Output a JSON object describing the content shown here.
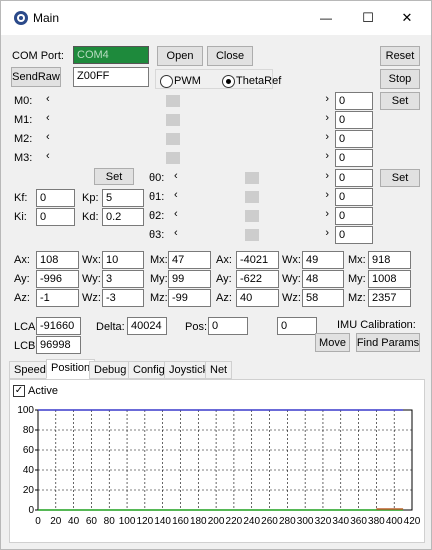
{
  "window": {
    "title": "Main",
    "minimize_glyph": "—",
    "maximize_glyph": "☐",
    "close_glyph": "✕"
  },
  "com": {
    "label": "COM Port:",
    "value": "COM4",
    "open": "Open",
    "close": "Close",
    "reset": "Reset",
    "stop": "Stop"
  },
  "send": {
    "button": "SendRaw",
    "value": "Z00FF",
    "pwm": "PWM",
    "thetaref": "ThetaRef",
    "mode": "ThetaRef"
  },
  "motors": [
    {
      "label": "M0:",
      "value": "0",
      "thumb": 0.44
    },
    {
      "label": "M1:",
      "value": "0",
      "thumb": 0.44
    },
    {
      "label": "M2:",
      "value": "0",
      "thumb": 0.44
    },
    {
      "label": "M3:",
      "value": "0",
      "thumb": 0.44
    }
  ],
  "motors_set": "Set",
  "gains": {
    "set": "Set",
    "kf_label": "Kf:",
    "kf": "0",
    "kp_label": "Kp:",
    "kp": "5",
    "ki_label": "Ki:",
    "ki": "0",
    "kd_label": "Kd:",
    "kd": "0.2"
  },
  "thetas": [
    {
      "label": "θ0:",
      "value": "0",
      "thumb": 0.5
    },
    {
      "label": "θ1:",
      "value": "0",
      "thumb": 0.5
    },
    {
      "label": "θ2:",
      "value": "0",
      "thumb": 0.5
    },
    {
      "label": "θ3:",
      "value": "0",
      "thumb": 0.5
    }
  ],
  "thetas_set": "Set",
  "imu": {
    "row_a": [
      [
        "Ax:",
        "108"
      ],
      [
        "Wx:",
        "10"
      ],
      [
        "Mx:",
        "47"
      ],
      [
        "Ax:",
        "-4021"
      ],
      [
        "Wx:",
        "49"
      ],
      [
        "Mx:",
        "918"
      ]
    ],
    "row_b": [
      [
        "Ay:",
        "-996"
      ],
      [
        "Wy:",
        "3"
      ],
      [
        "My:",
        "99"
      ],
      [
        "Ay:",
        "-622"
      ],
      [
        "Wy:",
        "48"
      ],
      [
        "My:",
        "1008"
      ]
    ],
    "row_c": [
      [
        "Az:",
        "-1"
      ],
      [
        "Wz:",
        "-3"
      ],
      [
        "Mz:",
        "-99"
      ],
      [
        "Az:",
        "40"
      ],
      [
        "Wz:",
        "58"
      ],
      [
        "Mz:",
        "2357"
      ]
    ]
  },
  "pos": {
    "lca_label": "LCA:",
    "lca": "-91660",
    "delta_label": "Delta:",
    "delta": "40024",
    "pos_label": "Pos:",
    "pos1": "0",
    "pos2": "0",
    "lcb_label": "LCB:",
    "lcb": "96998",
    "imu_cal": "IMU Calibration:",
    "move": "Move",
    "find": "Find Params"
  },
  "tabs": [
    "Speed",
    "Position",
    "Debug",
    "Config",
    "Joystick",
    "Net"
  ],
  "active_tab": "Position",
  "active_checkbox": {
    "label": "Active",
    "checked": true,
    "mark": "✓"
  },
  "chart_data": {
    "type": "line",
    "x_ticks": [
      "0",
      "20",
      "40",
      "60",
      "80",
      "100",
      "120",
      "140",
      "160",
      "180",
      "200",
      "220",
      "240",
      "260",
      "280",
      "300",
      "320",
      "340",
      "360",
      "380",
      "400",
      "420"
    ],
    "y_ticks": [
      "0",
      "20",
      "40",
      "60",
      "80",
      "100"
    ],
    "xlim": [
      0,
      420
    ],
    "ylim": [
      0,
      100
    ],
    "grid": true,
    "series": [
      {
        "color": "#3a3acc",
        "x": [
          0,
          410
        ],
        "y": [
          100,
          100
        ]
      },
      {
        "color": "#1fa01f",
        "x": [
          0,
          410
        ],
        "y": [
          0,
          0
        ]
      },
      {
        "color": "#c06030",
        "x": [
          380,
          410
        ],
        "y": [
          1,
          1
        ]
      }
    ]
  }
}
